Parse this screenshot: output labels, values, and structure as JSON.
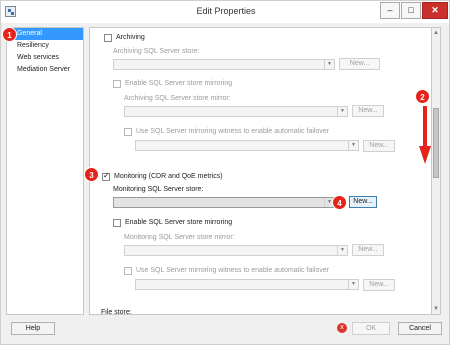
{
  "window": {
    "title": "Edit Properties",
    "controls": {
      "minimize": "–",
      "maximize": "□",
      "close": "✕"
    }
  },
  "nav": {
    "items": [
      {
        "label": "General",
        "selected": true
      },
      {
        "label": "Resiliency",
        "selected": false
      },
      {
        "label": "Web services",
        "selected": false
      },
      {
        "label": "Mediation Server",
        "selected": false
      }
    ]
  },
  "archiving": {
    "checkbox_label": "Archiving",
    "checked": false,
    "store_label": "Archiving SQL Server store:",
    "store_value": "",
    "new_label": "New...",
    "mirroring_label": "Enable SQL Server store mirroring",
    "mirror_store_label": "Archiving SQL Server store mirror:",
    "mirror_new_label": "New...",
    "witness_label": "Use SQL Server mirroring witness to enable automatic failover",
    "witness_new_label": "New..."
  },
  "monitoring": {
    "checkbox_label": "Monitoring (CDR and QoE metrics)",
    "checked": true,
    "store_label": "Monitoring SQL Server store:",
    "store_value": "",
    "new_label": "New...",
    "mirroring_label": "Enable SQL Server store mirroring",
    "mirror_store_label": "Monitoring SQL Server store mirror:",
    "mirror_new_label": "New...",
    "witness_label": "Use SQL Server mirroring witness to enable automatic failover",
    "witness_new_label": "New..."
  },
  "file_store_label": "File store:",
  "markers": [
    "1",
    "2",
    "3",
    "4"
  ],
  "footer": {
    "help": "Help",
    "ok": "OK",
    "cancel": "Cancel",
    "error_icon": "x"
  },
  "colors": {
    "marker": "#e5231b",
    "selection": "#3399ff"
  }
}
